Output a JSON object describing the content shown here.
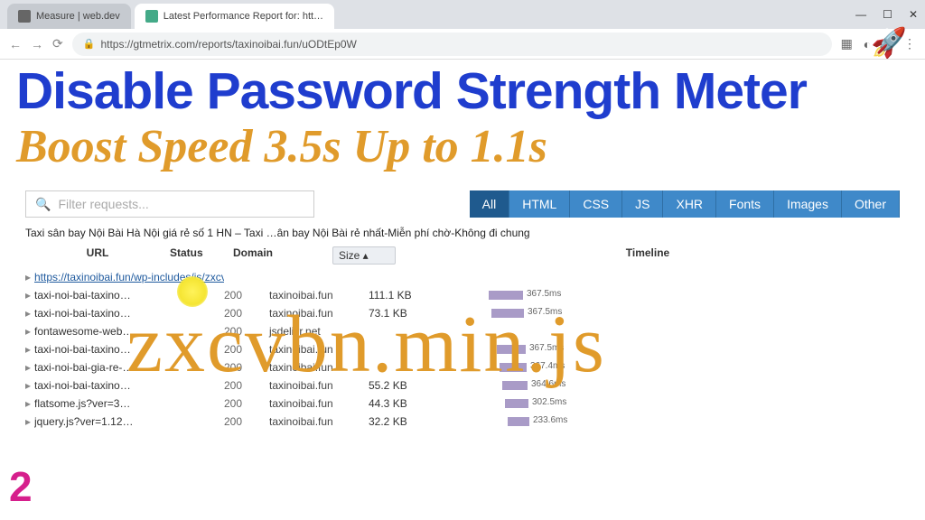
{
  "browser": {
    "tab1": "Measure  |  web.dev",
    "tab2": "Latest Performance Report for: htt…",
    "url": "https://gtmetrix.com/reports/taxinoibai.fun/uODtEp0W",
    "minimize": "—",
    "maximize": "☐",
    "close": "✕"
  },
  "overlay": {
    "headline": "Disable Password Strength Meter",
    "subhead": "Boost Speed 3.5s Up to 1.1s",
    "big": "zxcvbn.min.js",
    "badge": "2",
    "rocket": "🚀"
  },
  "filter": {
    "placeholder": "Filter requests...",
    "tabs": [
      "All",
      "HTML",
      "CSS",
      "JS",
      "XHR",
      "Fonts",
      "Images",
      "Other"
    ]
  },
  "caption": "Taxi sân bay Nội Bài Hà Nội giá rẻ số 1 HN – Taxi …ân bay Nội Bài rẻ nhất-Miễn phí chờ-Không đi chung",
  "headers": {
    "url": "URL",
    "status": "Status",
    "domain": "Domain",
    "size": "Size ▴",
    "timeline": "Timeline"
  },
  "rows": [
    {
      "url": "https://taxinoibai.fun/wp-includes/js/zxcvbn.min.js",
      "status": "",
      "domain": "",
      "size": "",
      "ms": "",
      "link": true
    },
    {
      "url": "taxi-noi-bai-taxino…",
      "status": "200",
      "domain": "taxinoibai.fun",
      "size": "111.1 KB",
      "ms": "367.5ms"
    },
    {
      "url": "taxi-noi-bai-taxino…",
      "status": "200",
      "domain": "taxinoibai.fun",
      "size": "73.1 KB",
      "ms": "367.5ms"
    },
    {
      "url": "fontawesome-web…",
      "status": "200",
      "domain": "jsdelivr.net",
      "size": "",
      "ms": ""
    },
    {
      "url": "taxi-noi-bai-taxino…",
      "status": "200",
      "domain": "taxinoibai.fun",
      "size": "",
      "ms": "367.5ms"
    },
    {
      "url": "taxi-noi-bai-gia-re-…",
      "status": "200",
      "domain": "taxinoibai.fun",
      "size": "",
      "ms": "367.4ms"
    },
    {
      "url": "taxi-noi-bai-taxino…",
      "status": "200",
      "domain": "taxinoibai.fun",
      "size": "55.2 KB",
      "ms": "364.6ms"
    },
    {
      "url": "flatsome.js?ver=3…",
      "status": "200",
      "domain": "taxinoibai.fun",
      "size": "44.3 KB",
      "ms": "302.5ms"
    },
    {
      "url": "jquery.js?ver=1.12…",
      "status": "200",
      "domain": "taxinoibai.fun",
      "size": "32.2 KB",
      "ms": "233.6ms"
    }
  ]
}
